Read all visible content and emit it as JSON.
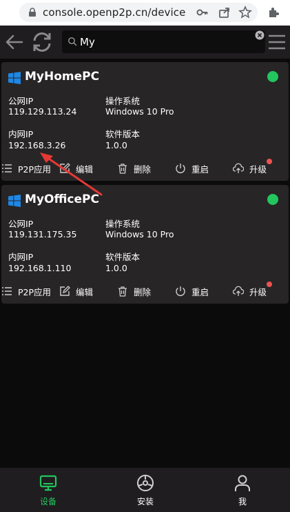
{
  "browser": {
    "url": "console.openp2p.cn/device"
  },
  "header": {
    "search_value": "My"
  },
  "devices": [
    {
      "name": "MyHomePC",
      "public_ip_label": "公网IP",
      "public_ip": "119.129.113.24",
      "os_label": "操作系统",
      "os": "Windows 10 Pro",
      "lan_ip_label": "内网IP",
      "lan_ip": "192.168.3.26",
      "version_label": "软件版本",
      "version": "1.0.0",
      "status": "online"
    },
    {
      "name": "MyOfficePC",
      "public_ip_label": "公网IP",
      "public_ip": "119.131.175.35",
      "os_label": "操作系统",
      "os": "Windows 10 Pro",
      "lan_ip_label": "内网IP",
      "lan_ip": "192.168.1.110",
      "version_label": "软件版本",
      "version": "1.0.0",
      "status": "online"
    }
  ],
  "actions": {
    "p2p": "P2P应用",
    "edit": "编辑",
    "delete": "删除",
    "restart": "重启",
    "upgrade": "升级"
  },
  "nav": {
    "devices": "设备",
    "install": "安装",
    "me": "我"
  },
  "colors": {
    "online": "#22c55e",
    "accent": "#22c55e",
    "badge": "#f05252",
    "card_bg": "#282526",
    "annotation": "#e53935"
  }
}
